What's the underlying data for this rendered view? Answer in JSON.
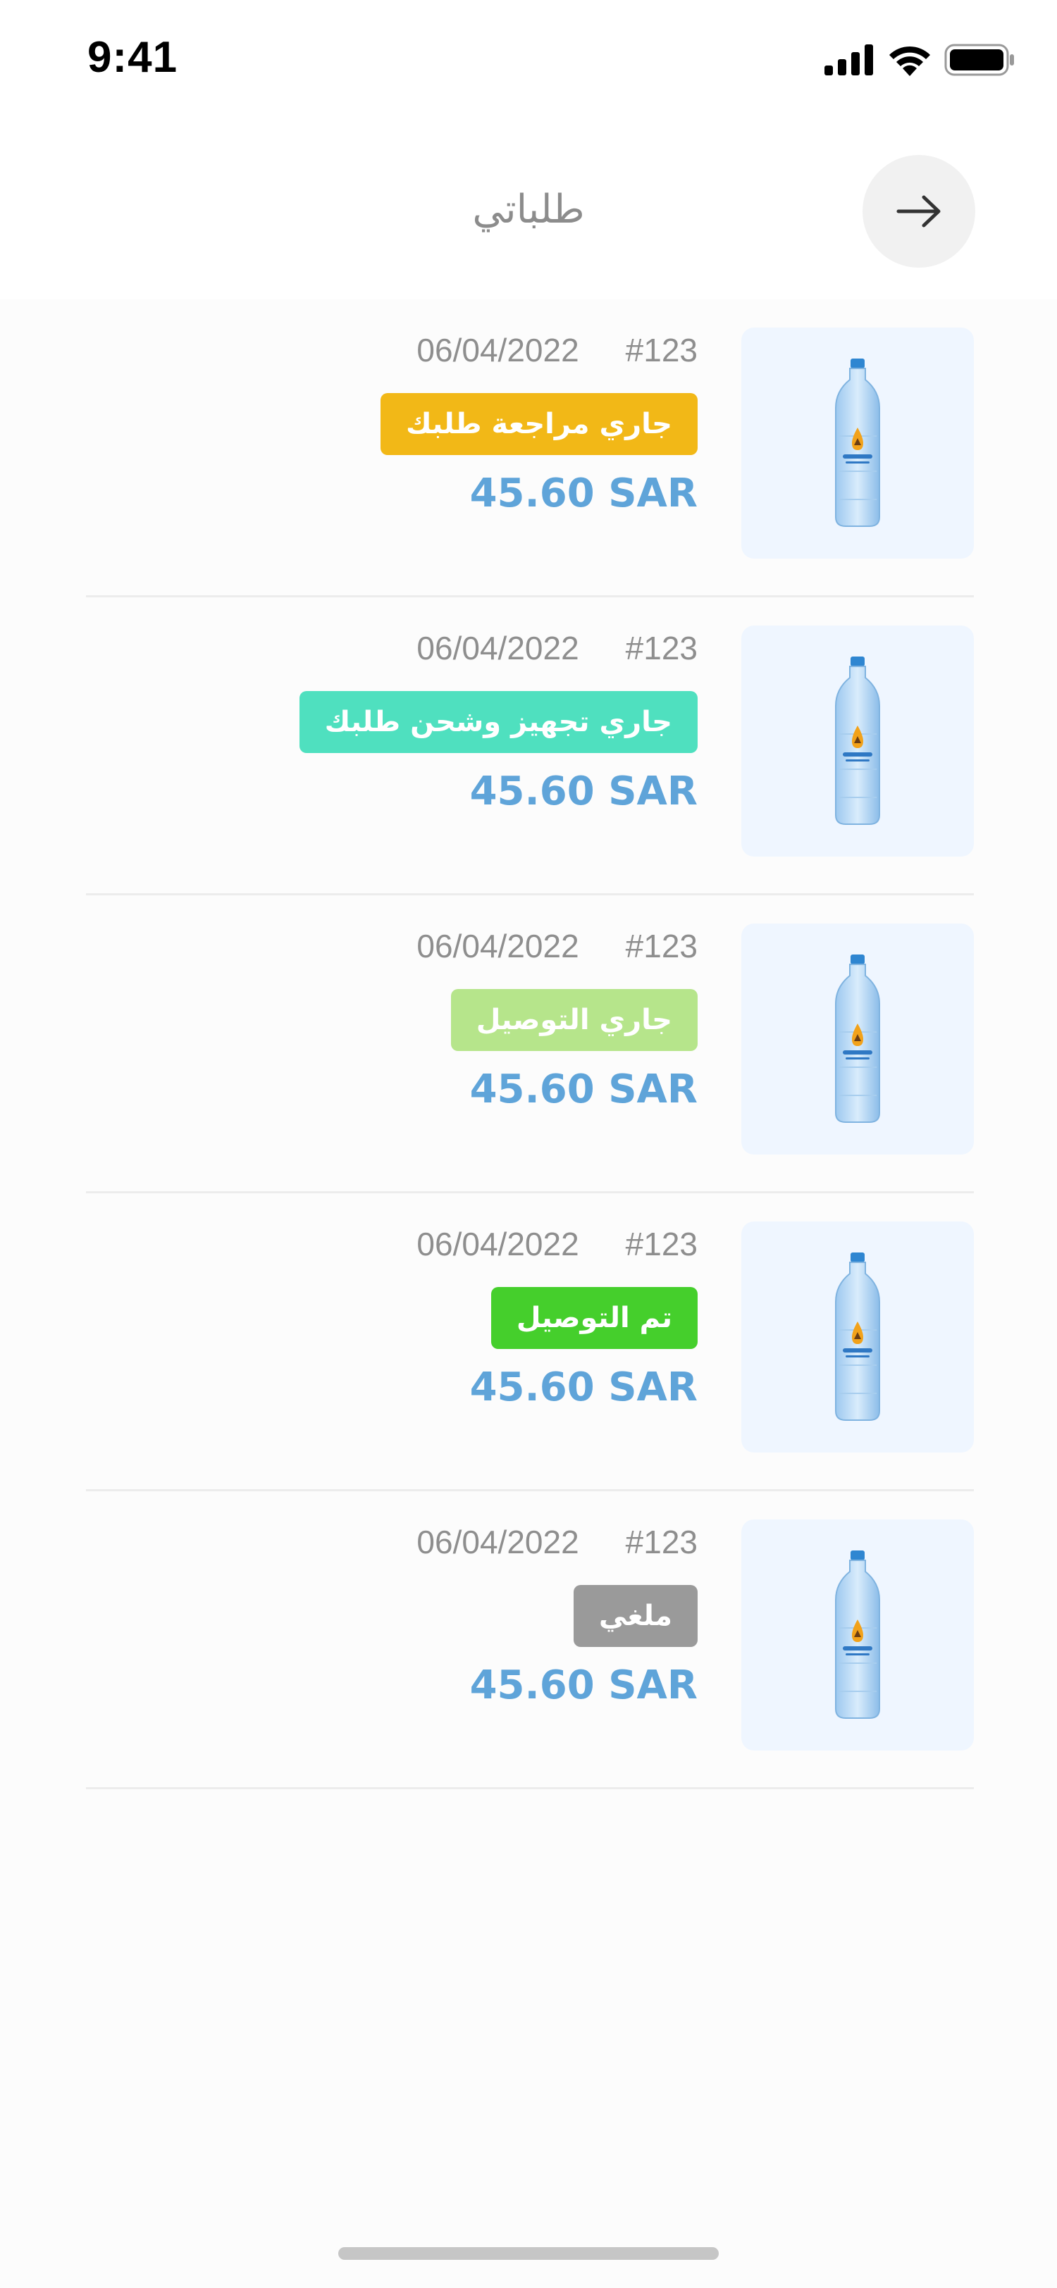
{
  "status_bar": {
    "time": "9:41"
  },
  "header": {
    "title": "طلباتي"
  },
  "orders": [
    {
      "order_number": "#123",
      "date": "06/04/2022",
      "status": "جاري مراجعة طلبك",
      "status_color": "#f2b817",
      "price": "45.60 SAR"
    },
    {
      "order_number": "#123",
      "date": "06/04/2022",
      "status": "جاري تجهيز وشحن طلبك",
      "status_color": "#4fe0bf",
      "price": "45.60 SAR"
    },
    {
      "order_number": "#123",
      "date": "06/04/2022",
      "status": "جاري التوصيل",
      "status_color": "#b6e58b",
      "price": "45.60 SAR"
    },
    {
      "order_number": "#123",
      "date": "06/04/2022",
      "status": "تم التوصيل",
      "status_color": "#45cf2c",
      "price": "45.60 SAR"
    },
    {
      "order_number": "#123",
      "date": "06/04/2022",
      "status": "ملغي",
      "status_color": "#9a9a9a",
      "price": "45.60 SAR"
    }
  ],
  "colors": {
    "price": "#5fa4d9",
    "thumbnail_background": "#eff6ff",
    "title": "#8c8c8c"
  },
  "icons": {
    "back": "arrow-right-icon",
    "product": "water-bottle-icon"
  }
}
